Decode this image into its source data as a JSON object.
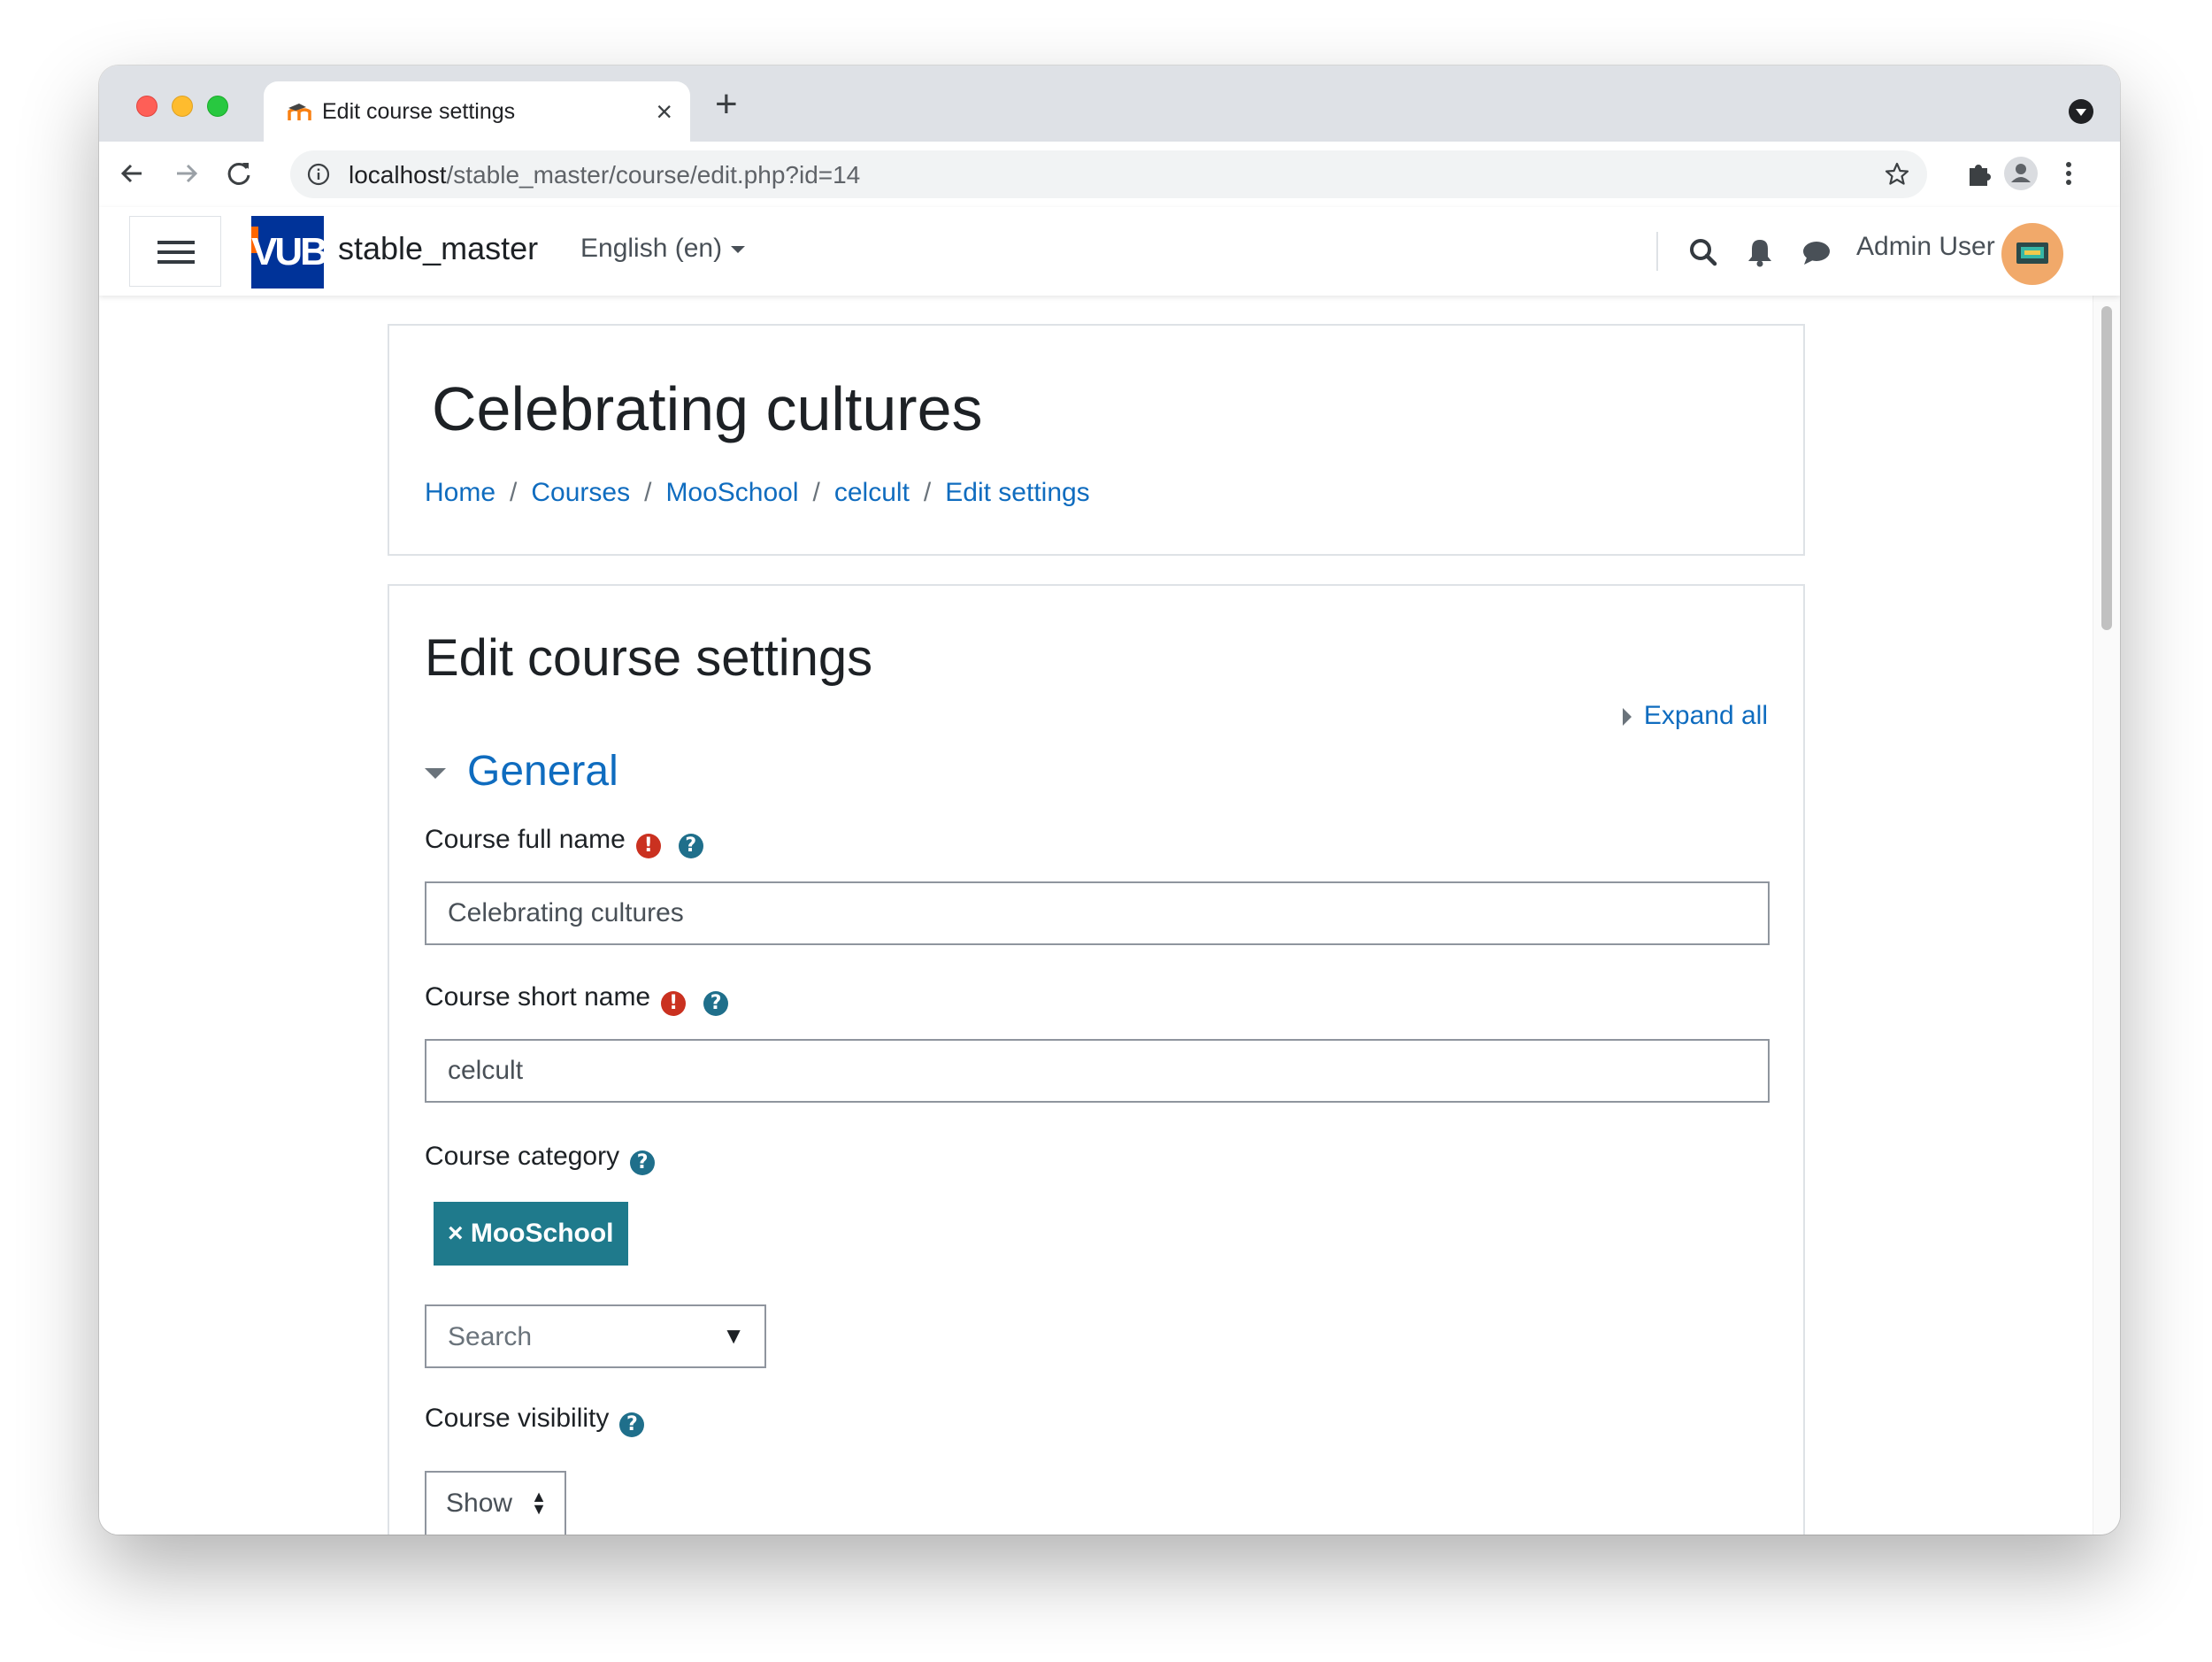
{
  "browser": {
    "tab_title": "Edit course settings",
    "tab_close": "×",
    "new_tab": "+",
    "url_host": "localhost",
    "url_path": "/stable_master/course/edit.php?id=14"
  },
  "navbar": {
    "logo_text": "VUB",
    "site_name": "stable_master",
    "language": "English (en)",
    "user_name": "Admin User"
  },
  "page": {
    "course_title": "Celebrating cultures",
    "breadcrumb": [
      "Home",
      "Courses",
      "MooSchool",
      "celcult",
      "Edit settings"
    ],
    "breadcrumb_sep": "/"
  },
  "form": {
    "title": "Edit course settings",
    "expand_all": "Expand all",
    "section_general": "General",
    "full_name_label": "Course full name",
    "full_name_value": "Celebrating cultures",
    "short_name_label": "Course short name",
    "short_name_value": "celcult",
    "category_label": "Course category",
    "category_selected": "× MooSchool",
    "category_search_placeholder": "Search",
    "category_search_arrow": "▼",
    "visibility_label": "Course visibility",
    "visibility_value": "Show"
  },
  "icons": {
    "required": "!",
    "help": "?",
    "updown": "▲▼"
  },
  "colors": {
    "link": "#0f6cbf",
    "required": "#ca3120",
    "help": "#1f6f8b",
    "tag": "#1f7a8c",
    "logo_bg": "#003399"
  }
}
